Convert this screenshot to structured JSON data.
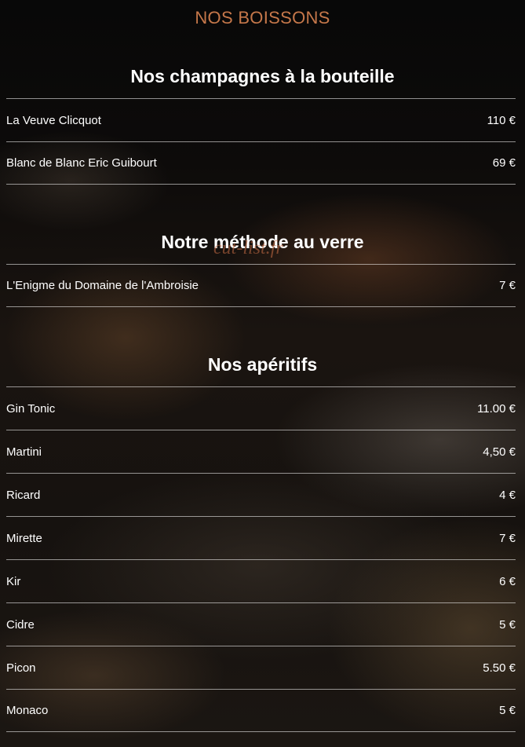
{
  "page": {
    "title": "NOS BOISSONS",
    "watermark": "cut-list.fr"
  },
  "sections": [
    {
      "title": "Nos champagnes à la bouteille",
      "items": [
        {
          "name": "La Veuve Clicquot",
          "price": "110 €"
        },
        {
          "name": "Blanc de Blanc Eric Guibourt",
          "price": "69 €"
        }
      ]
    },
    {
      "title": "Notre méthode au verre",
      "items": [
        {
          "name": "L'Enigme du Domaine de l'Ambroisie",
          "price": "7 €"
        }
      ]
    },
    {
      "title": "Nos apéritifs",
      "items": [
        {
          "name": "Gin Tonic",
          "price": "11.00 €"
        },
        {
          "name": "Martini",
          "price": "4,50 €"
        },
        {
          "name": "Ricard",
          "price": "4 €"
        },
        {
          "name": "Mirette",
          "price": "7 €"
        },
        {
          "name": "Kir",
          "price": "6 €"
        },
        {
          "name": "Cidre",
          "price": "5 €"
        },
        {
          "name": "Picon",
          "price": "5.50 €"
        },
        {
          "name": "Monaco",
          "price": "5 €"
        }
      ]
    }
  ],
  "colors": {
    "accent": "#c5774a",
    "text": "#ffffff",
    "background": "#0b0908"
  }
}
